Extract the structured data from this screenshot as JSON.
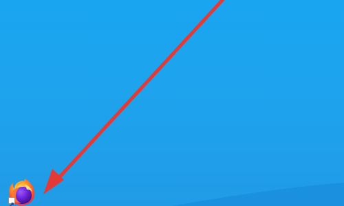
{
  "desktop": {
    "background_color": "#1aa2ed",
    "wallpaper_accent": "#0d7fcf"
  },
  "annotation": {
    "type": "arrow",
    "color": "#e43a36",
    "direction": "down-left",
    "target": "firefox-shortcut"
  },
  "shortcut": {
    "app_name": "Firefox",
    "icon": "firefox-icon",
    "shortcut_overlay_icon": "shortcut-arrow-icon"
  }
}
